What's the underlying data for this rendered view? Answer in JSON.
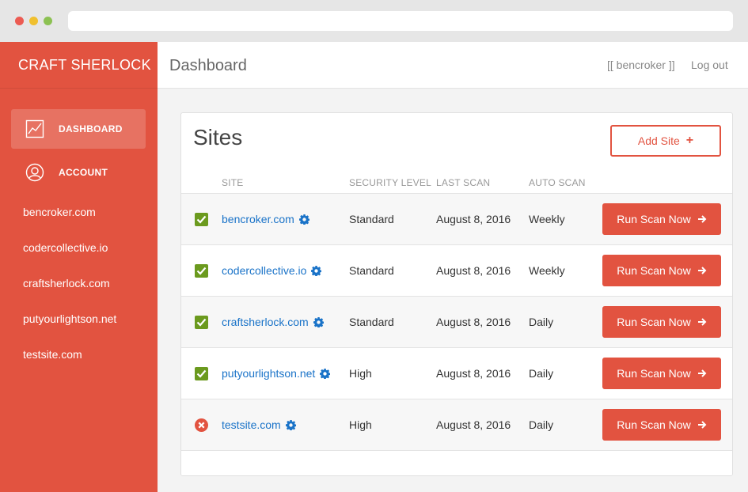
{
  "brand": "CRAFT SHERLOCK",
  "sidebar": {
    "nav": [
      {
        "label": "DASHBOARD",
        "icon": "chart-icon",
        "active": true
      },
      {
        "label": "ACCOUNT",
        "icon": "user-icon",
        "active": false
      }
    ],
    "sites": [
      "bencroker.com",
      "codercollective.io",
      "craftsherlock.com",
      "putyourlightson.net",
      "testsite.com"
    ]
  },
  "header": {
    "title": "Dashboard",
    "user": "[[ bencroker ]]",
    "logout": "Log out"
  },
  "panel": {
    "title": "Sites",
    "add_label": "Add Site",
    "columns": {
      "site": "SITE",
      "security": "SECURITY LEVEL",
      "last_scan": "LAST SCAN",
      "auto_scan": "AUTO SCAN"
    },
    "run_label": "Run Scan Now",
    "rows": [
      {
        "status": "ok",
        "site": "bencroker.com",
        "security": "Standard",
        "last_scan": "August 8, 2016",
        "auto_scan": "Weekly"
      },
      {
        "status": "ok",
        "site": "codercollective.io",
        "security": "Standard",
        "last_scan": "August 8, 2016",
        "auto_scan": "Weekly"
      },
      {
        "status": "ok",
        "site": "craftsherlock.com",
        "security": "Standard",
        "last_scan": "August 8, 2016",
        "auto_scan": "Daily"
      },
      {
        "status": "ok",
        "site": "putyourlightson.net",
        "security": "High",
        "last_scan": "August 8, 2016",
        "auto_scan": "Daily"
      },
      {
        "status": "error",
        "site": "testsite.com",
        "security": "High",
        "last_scan": "August 8, 2016",
        "auto_scan": "Daily"
      }
    ]
  },
  "colors": {
    "accent": "#e25340",
    "link": "#1a73c8",
    "ok": "#6b9a1e",
    "error": "#e25340"
  }
}
